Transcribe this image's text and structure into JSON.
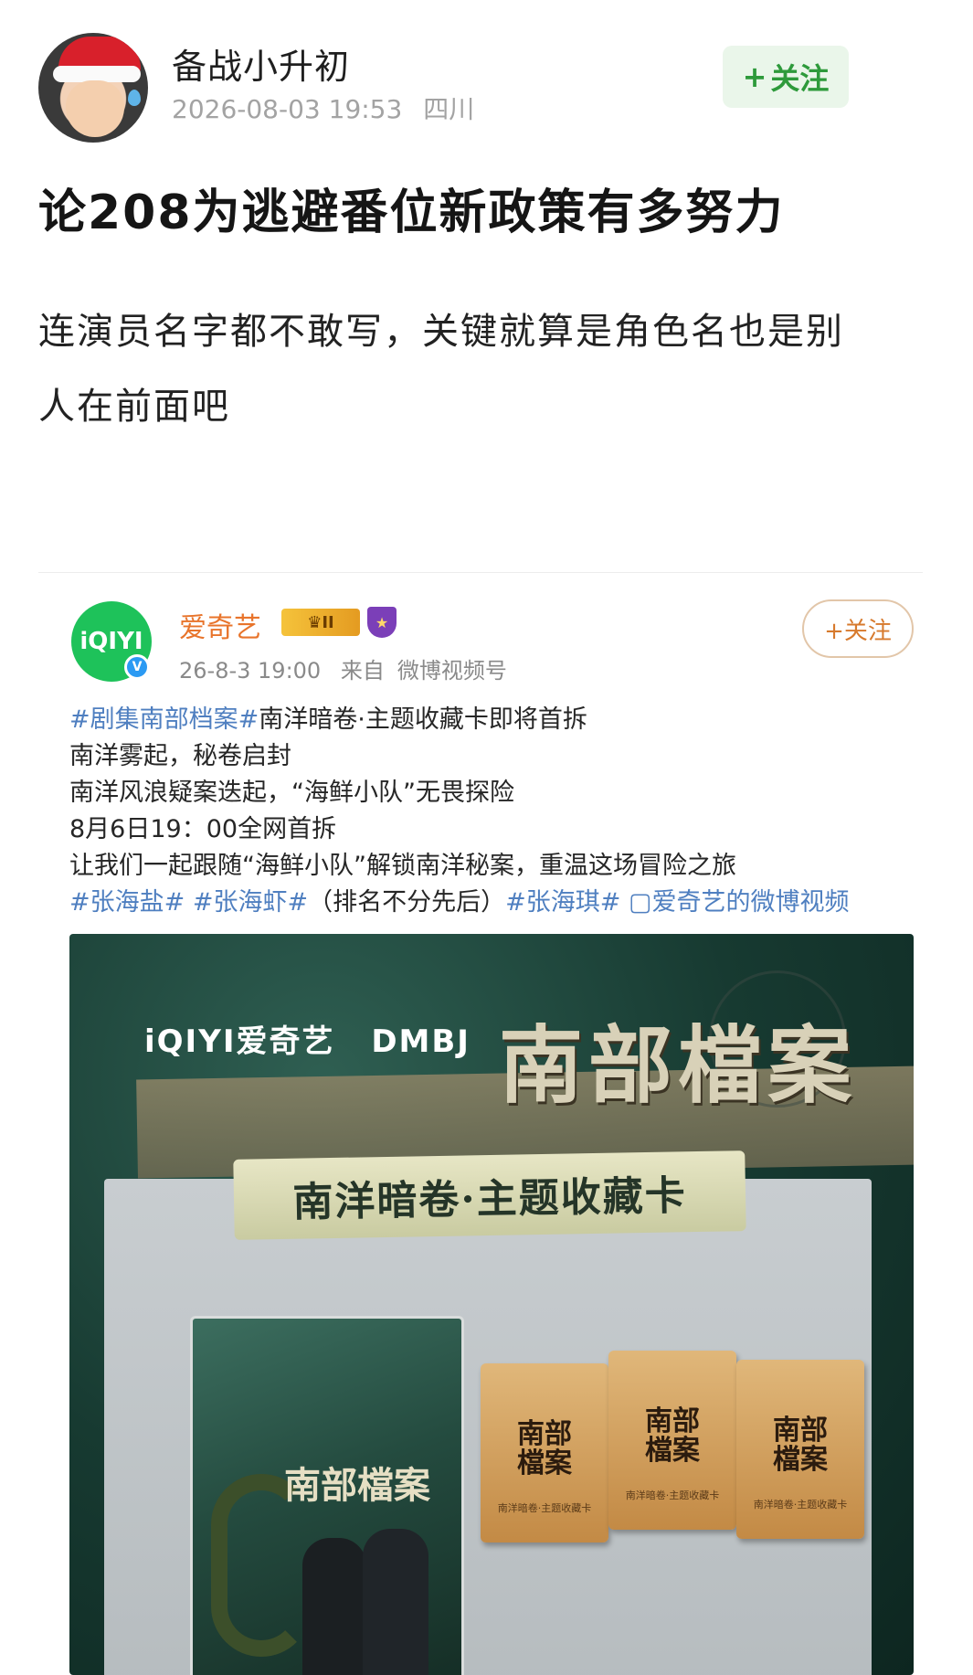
{
  "post": {
    "username": "备战小升初",
    "timestamp": "2026-08-03 19:53",
    "location": "四川",
    "follow_label": "关注",
    "follow_prefix": "+",
    "title": "论208为逃避番位新政策有多努力",
    "body": "连演员名字都不敢写，关键就算是角色名也是别人在前面吧"
  },
  "embed": {
    "avatar_text": "iQIYI",
    "verify_mark": "V",
    "name": "爱奇艺",
    "level_badge": "II",
    "timestamp": "26-8-3 19:00",
    "source_prefix": "来自",
    "source": "微博视频号",
    "follow_label": "+关注",
    "lines": {
      "l1_tag": "#剧集南部档案#",
      "l1_rest": "南洋暗卷·主题收藏卡即将首拆",
      "l2": "南洋雾起，秘卷启封",
      "l3": "南洋风浪疑案迭起，“海鲜小队”无畏探险",
      "l4": "8月6日19：00全网首拆",
      "l5": "让我们一起跟随“海鲜小队”解锁南洋秘案，重温这场冒险之旅",
      "l6_tag1": "#张海盐#",
      "l6_tag2": "#张海虾#",
      "l6_mid": "（排名不分先后）",
      "l6_tag3": "#张海琪#",
      "l6_link": "▢爱奇艺的微博视频"
    },
    "promo": {
      "logo_iqiyi": "iQIYI爱奇艺",
      "logo_dmbj": "DMBJ",
      "show_title": "南部檔案",
      "banner": "南洋暗卷·主题收藏卡",
      "box_title": "南部檔案",
      "pack_title": "南部檔案",
      "pack_sub": "南洋暗卷·主题收藏卡"
    }
  },
  "colors": {
    "follow_green": "#2e9a3b",
    "follow_bg": "#eaf6ea",
    "embed_name": "#e8742b",
    "tag_blue": "#4f7fc0"
  }
}
